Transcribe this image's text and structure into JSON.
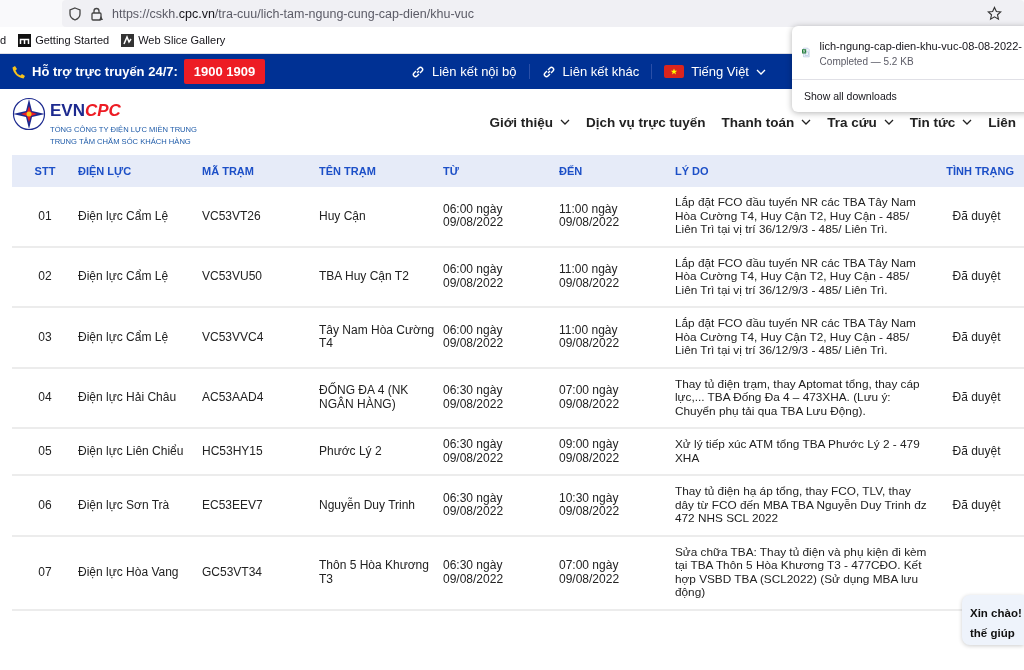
{
  "browser": {
    "url": "https://cskh.**cpc.vn**/tra-cuu/lich-tam-ngung-cung-cap-dien/khu-vuc",
    "bookmarks": [
      {
        "label": "d",
        "kind": "plain"
      },
      {
        "label": "Getting Started",
        "kind": "tile"
      },
      {
        "label": "Web Slice Gallery",
        "kind": "slice"
      }
    ]
  },
  "top_bar": {
    "hotline_label": "Hỗ trợ trực truyến 24/7:",
    "hotline_number": "1900 1909",
    "links": [
      {
        "label": "Liên kết nội bộ",
        "kind": "link",
        "dropdown": false
      },
      {
        "label": "Liên kết khác",
        "kind": "link",
        "dropdown": false
      },
      {
        "label": "Tiếng Việt",
        "kind": "language",
        "dropdown": true
      }
    ]
  },
  "header": {
    "logo_evn": "EVN",
    "logo_cpc": "CPC",
    "subtitle_lines": [
      "TỔNG CÔNG TY ĐIỆN LỰC MIỀN TRUNG",
      "TRUNG TÂM CHĂM SÓC KHÁCH HÀNG"
    ],
    "nav": [
      {
        "label": "Giới thiệu",
        "dropdown": true
      },
      {
        "label": "Dịch vụ trực tuyến",
        "dropdown": false
      },
      {
        "label": "Thanh toán",
        "dropdown": true
      },
      {
        "label": "Tra cứu",
        "dropdown": true
      },
      {
        "label": "Tin tức",
        "dropdown": true
      },
      {
        "label": "Liên",
        "dropdown": false
      }
    ]
  },
  "table": {
    "columns": [
      "STT",
      "ĐIỆN LỰC",
      "MÃ TRẠM",
      "TÊN TRẠM",
      "TỪ",
      "ĐẾN",
      "LÝ DO",
      "TÌNH TRẠNG"
    ],
    "rows": [
      [
        "01",
        "Điện lực Cẩm Lệ",
        "VC53VT26",
        "Huy Cận",
        "06:00 ngày 09/08/2022",
        "11:00 ngày 09/08/2022",
        "Lắp đặt FCO đầu tuyến NR các TBA Tây Nam Hòa Cường T4, Huy Cận T2, Huy Cận - 485/ Liên Trì tại vị trí 36/12/9/3 - 485/ Liên Trì.",
        "Đã duyệt"
      ],
      [
        "02",
        "Điện lực Cẩm Lệ",
        "VC53VU50",
        "TBA Huy Cận T2",
        "06:00 ngày 09/08/2022",
        "11:00 ngày 09/08/2022",
        "Lắp đặt FCO đầu tuyến NR các TBA Tây Nam Hòa Cường T4, Huy Cận T2, Huy Cận - 485/ Liên Trì tại vị trí 36/12/9/3 - 485/ Liên Trì.",
        "Đã duyệt"
      ],
      [
        "03",
        "Điện lực Cẩm Lệ",
        "VC53VVC4",
        "Tây Nam Hòa Cường T4",
        "06:00 ngày 09/08/2022",
        "11:00 ngày 09/08/2022",
        "Lắp đặt FCO đầu tuyến NR các TBA Tây Nam Hòa Cường T4, Huy Cận T2, Huy Cận - 485/ Liên Trì tại vị trí 36/12/9/3 - 485/ Liên Trì.",
        "Đã duyệt"
      ],
      [
        "04",
        "Điện lực Hải Châu",
        "AC53AAD4",
        "ĐỐNG ĐA 4 (NK NGÂN HÀNG)",
        "06:30 ngày 09/08/2022",
        "07:00 ngày 09/08/2022",
        "Thay tủ điện trạm, thay Aptomat tổng, thay cáp lực,... TBA Đống Đa 4 – 473XHA. (Lưu ý: Chuyển phụ tải qua TBA Lưu Động).",
        "Đã duyệt"
      ],
      [
        "05",
        "Điện lực Liên Chiểu",
        "HC53HY15",
        "Phước Lý 2",
        "06:30 ngày 09/08/2022",
        "09:00 ngày 09/08/2022",
        "Xử lý tiếp xúc ATM tổng TBA Phước Lý 2 - 479 XHA",
        "Đã duyệt"
      ],
      [
        "06",
        "Điện lực Sơn Trà",
        "EC53EEV7",
        "Nguyễn Duy Trinh",
        "06:30 ngày 09/08/2022",
        "10:30 ngày 09/08/2022",
        "Thay tủ điện hạ áp tổng, thay FCO, TLV, thay dây từ FCO đến MBA TBA Nguyễn Duy Trinh đz 472 NHS SCL 2022",
        "Đã duyệt"
      ],
      [
        "07",
        "Điện lực Hòa Vang",
        "GC53VT34",
        "Thôn 5 Hòa Khương T3",
        "06:30 ngày 09/08/2022",
        "07:00 ngày 09/08/2022",
        "Sửa chữa TBA: Thay tủ điện và phụ kiện đi kèm tại TBA Thôn 5 Hòa Khương T3 - 477CĐO. Kết hợp VSBD TBA (SCL2022) (Sử dụng MBA lưu động)",
        ""
      ]
    ]
  },
  "downloads": {
    "file_name": "lich-ngung-cap-dien-khu-vuc-08-08-2022-",
    "status": "Completed — 5.2 KB",
    "show_all": "Show all downloads"
  },
  "chat": {
    "lines": [
      "Xin chào!",
      "thế giúp"
    ]
  }
}
